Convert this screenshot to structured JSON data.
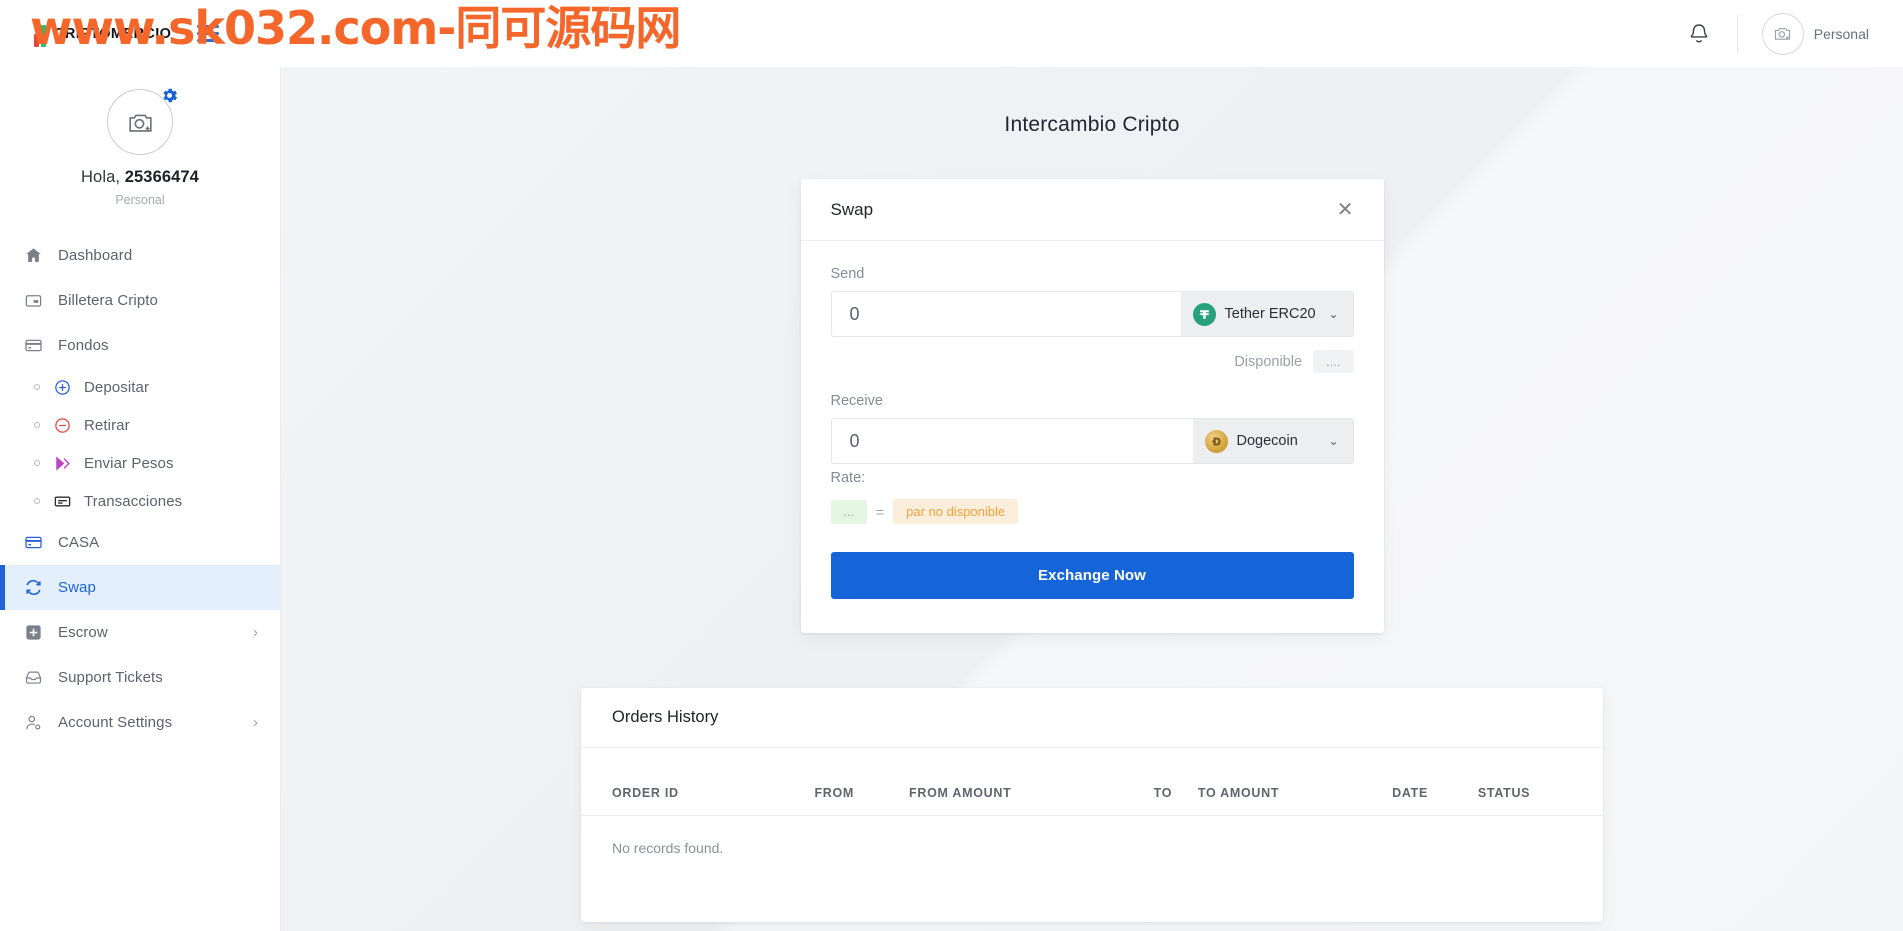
{
  "watermark": {
    "text": "www.sk032.com-同可源码网"
  },
  "header": {
    "brand_name": "CRIPTOMERCIO",
    "menu_icon": "hamburger-icon",
    "notification_icon": "bell-icon",
    "user_role": "Personal"
  },
  "sidebar": {
    "profile": {
      "greeting": "Hola, ",
      "username": "25366474",
      "role": "Personal",
      "avatar_icon": "camera-add-icon",
      "settings_icon": "gear-icon"
    },
    "items": [
      {
        "label": "Dashboard",
        "icon": "home-icon",
        "type": "main",
        "active": false,
        "chevron": false
      },
      {
        "label": "Billetera Cripto",
        "icon": "wallet-icon",
        "type": "main",
        "active": false,
        "chevron": false
      },
      {
        "label": "Fondos",
        "icon": "card-icon",
        "type": "main",
        "active": false,
        "chevron": false
      },
      {
        "label": "Depositar",
        "icon": "plus-circle-icon",
        "type": "sub",
        "active": false,
        "chevron": false
      },
      {
        "label": "Retirar",
        "icon": "minus-circle-icon",
        "type": "sub",
        "active": false,
        "chevron": false
      },
      {
        "label": "Enviar Pesos",
        "icon": "send-fast-icon",
        "type": "sub",
        "active": false,
        "chevron": false
      },
      {
        "label": "Transacciones",
        "icon": "transactions-icon",
        "type": "sub",
        "active": false,
        "chevron": false
      },
      {
        "label": "CASA",
        "icon": "casa-card-icon",
        "type": "main",
        "active": false,
        "chevron": false
      },
      {
        "label": "Swap",
        "icon": "swap-icon",
        "type": "main",
        "active": true,
        "chevron": false
      },
      {
        "label": "Escrow",
        "icon": "escrow-plus-icon",
        "type": "main",
        "active": false,
        "chevron": true
      },
      {
        "label": "Support Tickets",
        "icon": "inbox-icon",
        "type": "main",
        "active": false,
        "chevron": false
      },
      {
        "label": "Account Settings",
        "icon": "user-gear-icon",
        "type": "main",
        "active": false,
        "chevron": true
      }
    ]
  },
  "main": {
    "page_title": "Intercambio Cripto",
    "swap": {
      "title": "Swap",
      "close_icon": "close-icon",
      "send_label": "Send",
      "send_value": "0",
      "send_placeholder": "0",
      "send_coin": "Tether ERC20",
      "send_coin_symbol": "₮",
      "available_label": "Disponible",
      "available_value": "....",
      "receive_label": "Receive",
      "receive_value": "0",
      "receive_placeholder": "0",
      "receive_coin": "Dogecoin",
      "receive_coin_symbol": "Ð",
      "rate_label": "Rate:",
      "rate_value": "...",
      "rate_equals": "=",
      "rate_status": "par no disponible",
      "exchange_button": "Exchange Now"
    },
    "orders": {
      "title": "Orders History",
      "columns": [
        "ORDER ID",
        "FROM",
        "FROM AMOUNT",
        "TO",
        "TO AMOUNT",
        "DATE",
        "STATUS"
      ],
      "rows": [],
      "empty_message": "No records found."
    }
  },
  "colors": {
    "accent": "#1565d8",
    "active_bg": "#e3effd",
    "usdt_green": "#26a17b",
    "doge_gold": "#d4a63c",
    "rate_green_bg": "#e4f5e2",
    "rate_orange_bg": "#fdeedb",
    "watermark_orange": "#f4662a"
  }
}
